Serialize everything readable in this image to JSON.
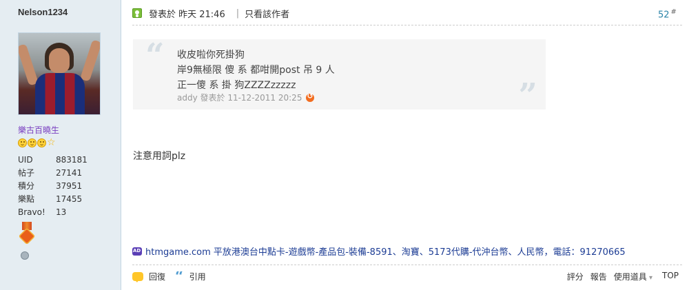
{
  "author": {
    "username": "Nelson1234",
    "rank_title": "樂古百曉生",
    "stats": [
      {
        "key": "UID",
        "value": "883181"
      },
      {
        "key": "帖子",
        "value": "27141"
      },
      {
        "key": "積分",
        "value": "37951"
      },
      {
        "key": "樂點",
        "value": "17455"
      },
      {
        "key": "Bravo!",
        "value": "13"
      }
    ]
  },
  "post": {
    "posted_label": "發表於 昨天 21:46",
    "author_only": "只看該作者",
    "floor_number": "52",
    "floor_mark": "#",
    "quote": {
      "lines": [
        "收皮啦你死掛狗",
        "岸9無極限 傻 系 都咁開post 吊 9 人",
        "正一傻 系 掛 狗ZZZZzzzzz"
      ],
      "meta": "addy 發表於 11-12-2011 20:25"
    },
    "body": "注意用詞plz",
    "ad_text": "htmgame.com 平放港澳台中點卡-遊戲幣-產品包-裝備-8591、淘寶、5173代購-代沖台幣、人民幣，電話：91270665"
  },
  "footer": {
    "reply": "回復",
    "quote": "引用",
    "rate": "評分",
    "report": "報告",
    "tools": "使用道具",
    "top": "TOP"
  }
}
